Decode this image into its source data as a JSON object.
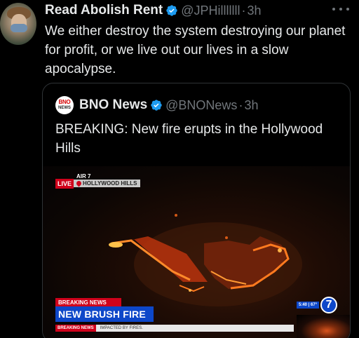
{
  "tweet": {
    "author_name": "Read Abolish Rent",
    "handle": "@JPHilllllll",
    "separator": "·",
    "time": "3h",
    "text": "We either destroy the system destroying our planet for profit, or we live out our lives in a slow apocalypse."
  },
  "quote": {
    "logo_line1": "BNO",
    "logo_line2": "NEWS",
    "author_name": "BNO News",
    "handle": "@BNONews",
    "separator": "·",
    "time": "3h",
    "text": "BREAKING: New fire erupts in the Hollywood Hills",
    "media": {
      "live_label": "LIVE",
      "station_label": "AIR 7",
      "location_label": "HOLLYWOOD HILLS",
      "breaking_tag": "BREAKING NEWS",
      "headline": "NEW BRUSH FIRE",
      "ticker_tag": "BREAKING NEWS",
      "ticker_text": "IMPACTED BY FIRES.",
      "time_temp": "5:40 | 67°",
      "network_small": "abc",
      "network_num": "7"
    }
  },
  "colors": {
    "background": "#000000",
    "text": "#e7e9ea",
    "muted": "#71767b",
    "verified": "#1d9bf0",
    "border": "#2f3336",
    "news_red": "#d0021b",
    "news_blue": "#0d47c9"
  }
}
